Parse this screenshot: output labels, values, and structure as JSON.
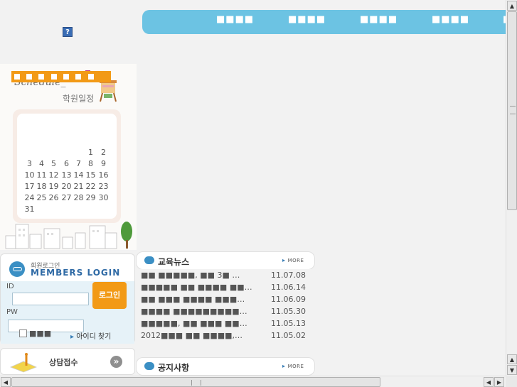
{
  "nav": {
    "items": [
      "■■■■",
      "■■■■",
      "■■■■",
      "■■■■",
      "■"
    ]
  },
  "help": {
    "label": "?"
  },
  "schedule": {
    "title": "Schedule_",
    "subtitle": "학원일정",
    "year": "2011",
    "month": "7",
    "days": [
      "1",
      "2",
      "3",
      "4",
      "5",
      "6",
      "7",
      "8",
      "9",
      "10",
      "11",
      "12",
      "13",
      "14",
      "15",
      "16",
      "17",
      "18",
      "19",
      "20",
      "21",
      "22",
      "23",
      "24",
      "25",
      "26",
      "27",
      "28",
      "29",
      "30",
      "31"
    ]
  },
  "login": {
    "title_kr": "회원로그인",
    "title_en": "MEMBERS LOGIN",
    "id_label": "ID",
    "pw_label": "PW",
    "button": "로그인",
    "save_label": "■■■",
    "find": "아이디 찾기"
  },
  "consult": {
    "label": "상담접수"
  },
  "news": {
    "title": "교육뉴스",
    "more": "MORE",
    "rows": [
      {
        "text": "■■ ■■■■■, ■■ 3■ …",
        "date": "11.07.08"
      },
      {
        "text": "■■■■■ ■■ ■■■■ ■■…",
        "date": "11.06.14"
      },
      {
        "text": "■■ ■■■ ■■■■ ■■■…",
        "date": "11.06.09"
      },
      {
        "text": "■■■■ ■■■■■■■■■…",
        "date": "11.05.30"
      },
      {
        "text": "■■■■■, ■■ ■■■ ■■…",
        "date": "11.05.13"
      },
      {
        "text": "2012■■■ ■■ ■■■■,…",
        "date": "11.05.02"
      }
    ]
  },
  "notice": {
    "title": "공지사항",
    "more": "MORE"
  },
  "colors": {
    "nav": "#6cc3e3",
    "accent": "#f29a16",
    "link_blue": "#2f8ec5"
  }
}
